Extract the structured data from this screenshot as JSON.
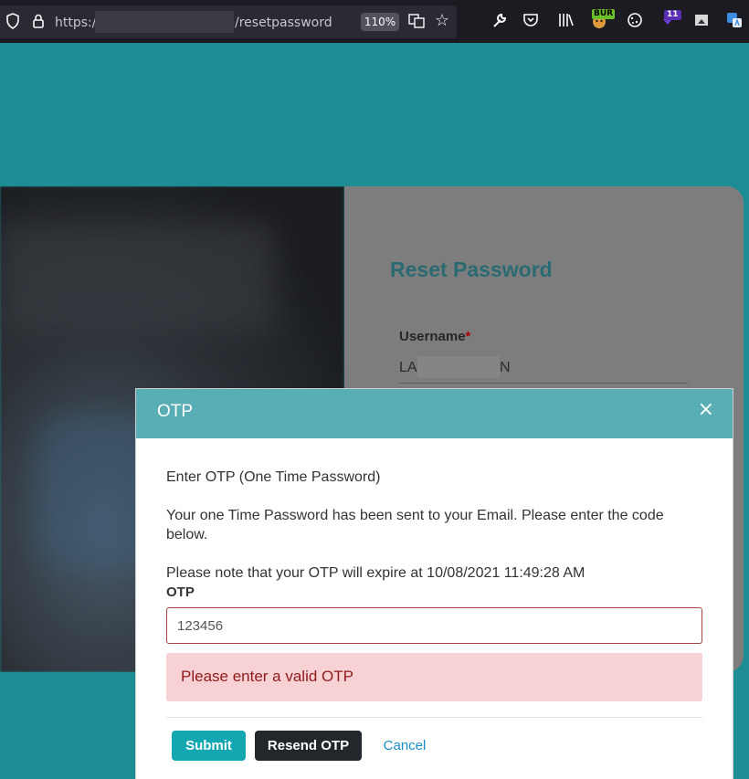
{
  "browser": {
    "url_prefix": "https://",
    "url_path": "/resetpassword",
    "zoom": "110%",
    "ext_badge_bur": "BUR",
    "ext_badge_count": "11"
  },
  "page": {
    "title": "Reset Password",
    "username_label": "Username",
    "required_marker": "*",
    "username_start": "LA",
    "username_end": "N"
  },
  "modal": {
    "title": "OTP",
    "close_label": "×",
    "instruction": "Enter OTP (One Time Password)",
    "sent_message": "Your one Time Password has been sent to your Email. Please enter the code below.",
    "expiry_message": "Please note that your OTP will expire at 10/08/2021 11:49:28 AM",
    "otp_label": "OTP",
    "otp_value": "123456",
    "error_message": "Please enter a valid OTP",
    "submit_label": "Submit",
    "resend_label": "Resend OTP",
    "cancel_label": "Cancel"
  },
  "colors": {
    "page_bg": "#1c8d92",
    "modal_header": "#58aeb4",
    "submit_btn": "#12a7b1",
    "resend_btn": "#23272b",
    "error_bg": "#f8d1d4",
    "error_text": "#8f1a1a"
  }
}
